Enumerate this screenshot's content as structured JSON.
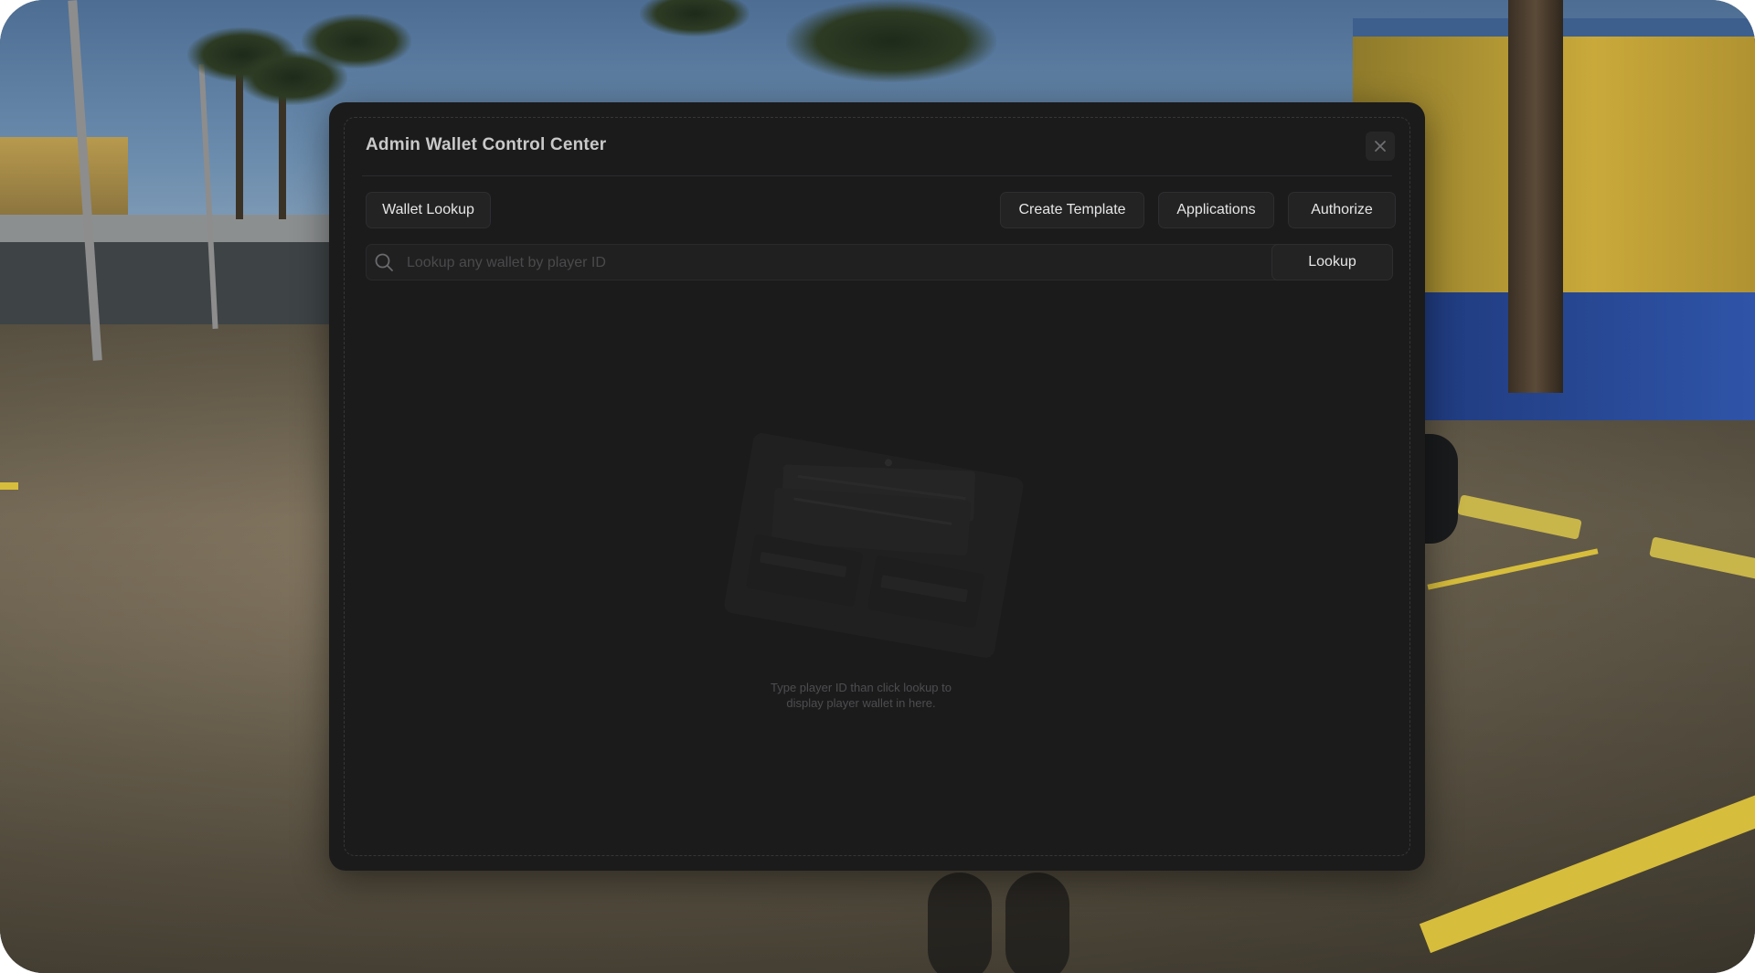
{
  "window": {
    "title": "Admin Wallet Control Center",
    "close_icon": "close-icon"
  },
  "tabs": [
    {
      "label": "Wallet Lookup"
    },
    {
      "label": "Create Template"
    },
    {
      "label": "Applications"
    },
    {
      "label": "Authorize"
    }
  ],
  "search": {
    "placeholder": "Lookup any wallet by player ID",
    "value": "",
    "icon": "search-icon",
    "button_label": "Lookup"
  },
  "empty_state": {
    "illustration": "wallet-icon",
    "message_line1": "Type player ID than click lookup to",
    "message_line2": "display player wallet in here."
  },
  "colors": {
    "modal_bg": "#1b1b1c",
    "button_bg": "#232324",
    "text_primary": "#e6e6e6",
    "text_muted": "#4d4d50"
  }
}
